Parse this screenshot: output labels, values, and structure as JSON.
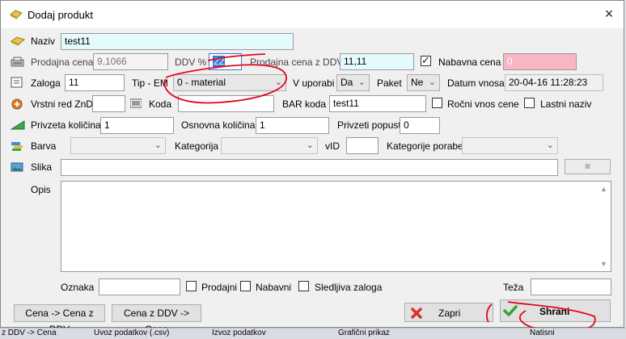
{
  "window": {
    "title": "Dodaj produkt",
    "close_glyph": "×"
  },
  "form": {
    "naziv": {
      "label": "Naziv",
      "value": "test11"
    },
    "prodajna_cena": {
      "label": "Prodajna cena",
      "value": "9,1066"
    },
    "ddv": {
      "label": "DDV %",
      "value": "22"
    },
    "prodajna_cena_ddv": {
      "label": "Prodajna cena z DDV",
      "value": "11,11"
    },
    "nabavna_cena": {
      "label": "Nabavna cena",
      "value": "0",
      "checked": true
    },
    "zaloga": {
      "label": "Zaloga",
      "value": "11"
    },
    "tip_em": {
      "label": "Tip - EM",
      "value": "0 - material"
    },
    "v_uporabi": {
      "label": "V uporabi",
      "value": "Da"
    },
    "paket": {
      "label": "Paket",
      "value": "Ne"
    },
    "datum_vnosa": {
      "label": "Datum vnosa",
      "value": "20-04-16 11:28:23"
    },
    "vrstni_red": {
      "label": "Vrstni red ZnD",
      "value": ""
    },
    "koda": {
      "label": "Koda",
      "value": ""
    },
    "bar_koda": {
      "label": "BAR koda",
      "value": "test11"
    },
    "rocni_vnos": {
      "label": "Ročni vnos cene"
    },
    "lastni_naziv": {
      "label": "Lastni naziv"
    },
    "privzeta_kolicina": {
      "label": "Privzeta količina",
      "value": "1"
    },
    "osnovna_kolicina": {
      "label": "Osnovna količina",
      "value": "1"
    },
    "privzeti_popust": {
      "label": "Privzeti popust",
      "value": "0"
    },
    "barva": {
      "label": "Barva",
      "value": ""
    },
    "kategorija": {
      "label": "Kategorija",
      "value": ""
    },
    "vid": {
      "label": "vID",
      "value": ""
    },
    "kategorije_porabe": {
      "label": "Kategorije porabe",
      "value": ""
    },
    "slika": {
      "label": "Slika",
      "value": "",
      "browse_glyph": "≡"
    },
    "opis": {
      "label": "Opis",
      "value": ""
    },
    "oznaka": {
      "label": "Oznaka",
      "value": ""
    },
    "prodajni": {
      "label": "Prodajni"
    },
    "nabavni": {
      "label": "Nabavni"
    },
    "sledljiva_zaloga": {
      "label": "Sledljiva zaloga"
    },
    "teza": {
      "label": "Teža",
      "value": ""
    }
  },
  "buttons": {
    "cena_to_ddv": "Cena -> Cena z DDV",
    "ddv_to_cena": "Cena z DDV -> Cena",
    "zapri": "Zapri",
    "shrani": "Shrani"
  },
  "taskbar": {
    "items": [
      "z DDV -> Cena",
      "Uvoz podatkov (.csv)",
      "Izvoz podatkov",
      "Grafični prikaz",
      "Natisni"
    ]
  },
  "colors": {
    "highlight_cyan": "#e4fafc",
    "highlight_pink": "#f7b6c2",
    "annotation_red": "#e2061a",
    "ok_green": "#3aa12e",
    "cancel_red": "#d9312b"
  }
}
